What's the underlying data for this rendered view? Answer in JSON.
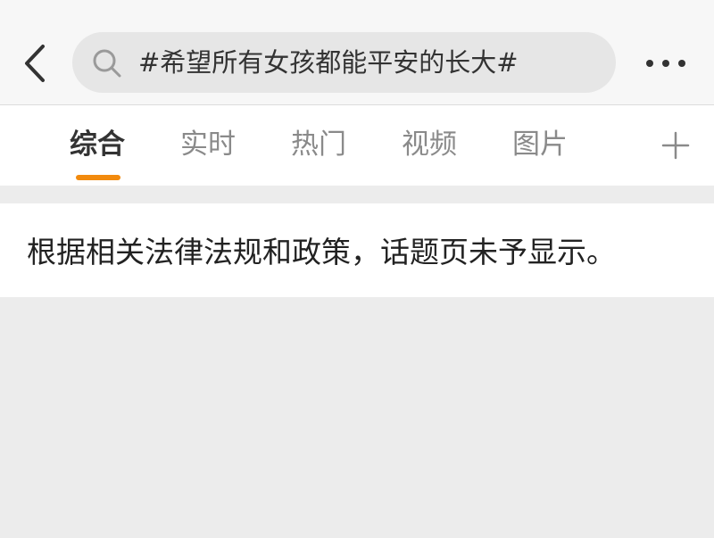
{
  "header": {
    "back_icon": "chevron-left-icon",
    "search": {
      "icon": "search-icon",
      "query": "#希望所有女孩都能平安的长大#"
    },
    "more_icon": "more-dots-icon"
  },
  "tabs": [
    {
      "label": "综合",
      "active": true
    },
    {
      "label": "实时",
      "active": false
    },
    {
      "label": "热门",
      "active": false
    },
    {
      "label": "视频",
      "active": false
    },
    {
      "label": "图片",
      "active": false
    }
  ],
  "add_tab_icon": "plus-icon",
  "notice": {
    "text": "根据相关法律法规和政策，话题页未予显示。"
  },
  "colors": {
    "accent": "#f28a0d",
    "page_background": "#ececec",
    "header_background": "#f7f7f7",
    "search_background": "#e6e6e6"
  }
}
